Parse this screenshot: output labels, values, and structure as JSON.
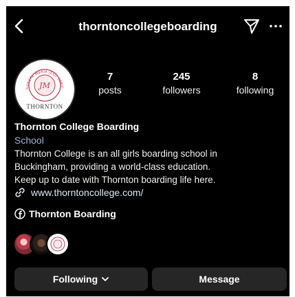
{
  "header": {
    "username": "thorntoncollegeboarding",
    "back_icon": "chevron-left-icon",
    "direct_icon": "paper-plane-icon",
    "more_icon": "more-horizontal-icon"
  },
  "profile": {
    "avatar_initials": "JM",
    "avatar_caption": "THORNTON",
    "avatar_ring_text": "SANCTA MARIA JESU SERVIT",
    "stats": [
      {
        "value": "7",
        "label": "posts"
      },
      {
        "value": "245",
        "label": "followers"
      },
      {
        "value": "8",
        "label": "following"
      }
    ],
    "name": "Thornton College Boarding",
    "category": "School",
    "bio_lines": [
      "Thornton College is an all girls boarding school in",
      "Buckingham, providing a world-class education.",
      "Keep up to date with Thornton boarding life here."
    ],
    "link": "www.thorntoncollege.com/",
    "facebook_label": "Thornton Boarding"
  },
  "actions": {
    "following_label": "Following",
    "message_label": "Message"
  },
  "colors": {
    "background": "#000000",
    "button": "#262626",
    "category": "#9fb6d6",
    "crest": "#c4344e"
  }
}
